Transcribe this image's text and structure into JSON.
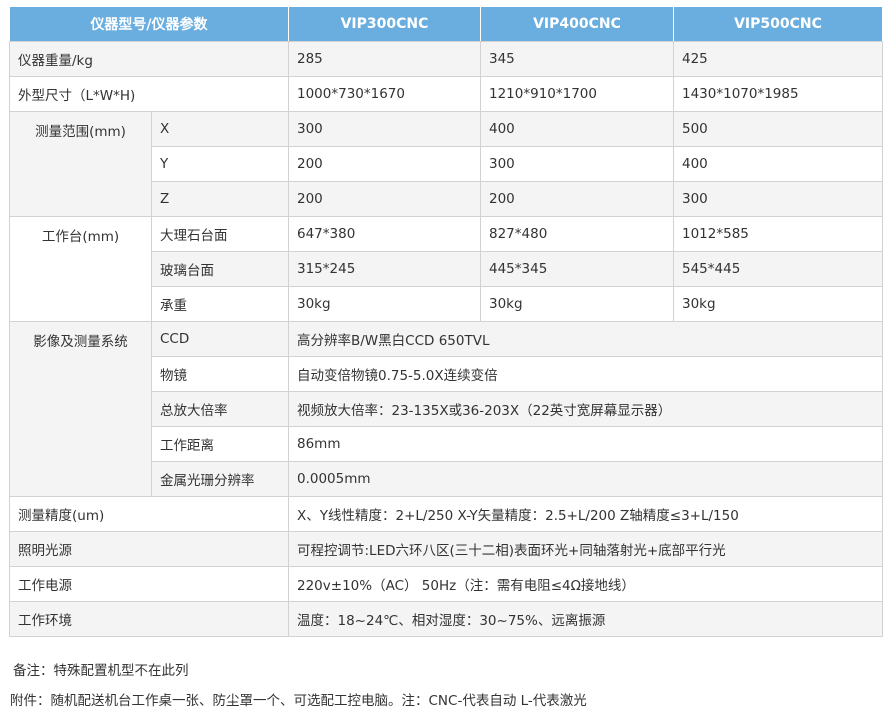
{
  "header": {
    "col0": "仪器型号/仪器参数",
    "col1": "VIP300CNC",
    "col2": "VIP400CNC",
    "col3": "VIP500CNC"
  },
  "rows": {
    "weight": {
      "label": "仪器重量/kg",
      "v1": "285",
      "v2": "345",
      "v3": "425"
    },
    "size": {
      "label": "外型尺寸（L*W*H)",
      "v1": "1000*730*1670",
      "v2": "1210*910*1700",
      "v3": "1430*1070*1985"
    },
    "range": {
      "label": "测量范围(mm)",
      "x": {
        "label": "X",
        "v1": "300",
        "v2": "400",
        "v3": "500"
      },
      "y": {
        "label": "Y",
        "v1": "200",
        "v2": "300",
        "v3": "400"
      },
      "z": {
        "label": "Z",
        "v1": "200",
        "v2": "200",
        "v3": "300"
      }
    },
    "table": {
      "label": "工作台(mm)",
      "marble": {
        "label": "大理石台面",
        "v1": "647*380",
        "v2": "827*480",
        "v3": "1012*585"
      },
      "glass": {
        "label": "玻璃台面",
        "v1": "315*245",
        "v2": "445*345",
        "v3": "545*445"
      },
      "load": {
        "label": "承重",
        "v1": "30kg",
        "v2": "30kg",
        "v3": "30kg"
      }
    },
    "imaging": {
      "label": "影像及测量系统",
      "ccd": {
        "label": "CCD",
        "value": "高分辨率B/W黑白CCD 650TVL"
      },
      "lens": {
        "label": "物镜",
        "value": "自动变倍物镜0.75-5.0X连续变倍"
      },
      "mag": {
        "label": "总放大倍率",
        "value": "视频放大倍率：23-135X或36-203X（22英寸宽屏幕显示器）"
      },
      "wd": {
        "label": "工作距离",
        "value": "86mm"
      },
      "grating": {
        "label": "金属光珊分辨率",
        "value": "0.0005mm"
      }
    },
    "accuracy": {
      "label": "测量精度(um)",
      "value": "X、Y线性精度：2+L/250   X-Y矢量精度：2.5+L/200  Z轴精度≤3+L/150"
    },
    "light": {
      "label": "照明光源",
      "value": "可程控调节:LED六环八区(三十二相)表面环光+同轴落射光+底部平行光"
    },
    "power": {
      "label": "工作电源",
      "value": "220v±10%（AC） 50Hz（注：需有电阻≤4Ω接地线）"
    },
    "env": {
      "label": "工作环境",
      "value": "温度：18~24℃、相对湿度：30~75%、远离振源"
    }
  },
  "notes": {
    "note1": "备注：特殊配置机型不在此列",
    "note2": "附件：随机配送机台工作桌一张、防尘罩一个、可选配工控电脑。注：CNC-代表自动 L-代表激光"
  },
  "colors": {
    "header_bg": "#6aaee0",
    "border": "#d2d2d2",
    "shade": "#f4f4f4"
  }
}
